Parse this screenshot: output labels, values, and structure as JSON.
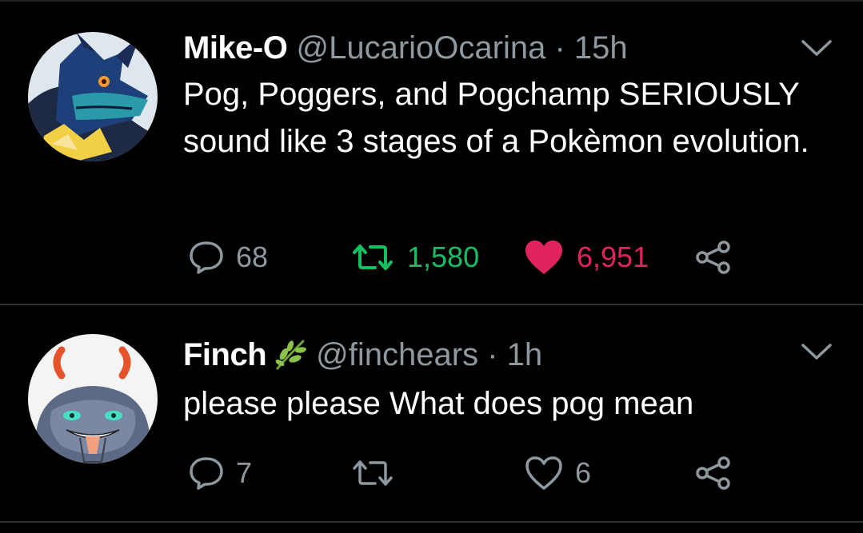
{
  "colors": {
    "background": "#000000",
    "text": "#ffffff",
    "muted": "#8e989f",
    "retweet_active": "#17bf63",
    "like_active": "#e0245e",
    "divider": "#2a2e32"
  },
  "tweets": [
    {
      "name": "Mike-O",
      "handle": "@LucarioOcarina",
      "separator": "·",
      "time": "15h",
      "text": "Pog, Poggers, and Pogchamp SERIOUSLY sound like 3 stages of a Pokèmon evolution.",
      "replies": "68",
      "retweets": "1,580",
      "likes": "6,951",
      "retweeted": true,
      "liked": true,
      "avatar_icon": "lucario-avatar-icon"
    },
    {
      "name": "Finch",
      "name_emoji": "herb-emoji-icon",
      "handle": "@finchears",
      "separator": "·",
      "time": "1h",
      "text": "please please What does pog mean",
      "replies": "7",
      "retweets": "",
      "likes": "6",
      "retweeted": false,
      "liked": false,
      "avatar_icon": "grinning-creature-avatar-icon"
    }
  ]
}
